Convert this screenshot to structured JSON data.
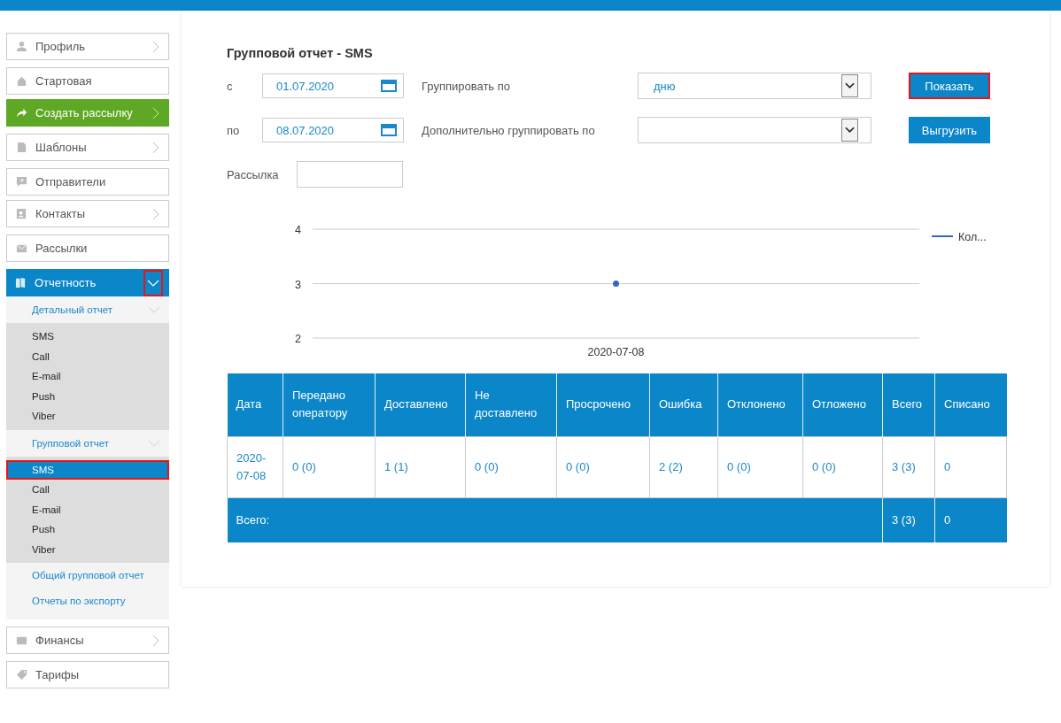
{
  "sidebar": {
    "groups": [
      {
        "items": [
          {
            "kind": "item",
            "label": "Профиль",
            "chevron": true
          }
        ]
      },
      {
        "items": [
          {
            "kind": "item",
            "label": "Стартовая",
            "chevron": false
          },
          {
            "kind": "primary",
            "label": "Создать рассылку",
            "chevron": true
          }
        ]
      },
      {
        "items": [
          {
            "kind": "item",
            "label": "Шаблоны",
            "chevron": true
          }
        ]
      },
      {
        "items": [
          {
            "kind": "item",
            "label": "Отправители",
            "chevron": false
          },
          {
            "kind": "item",
            "label": "Контакты",
            "chevron": true
          }
        ]
      },
      {
        "items": [
          {
            "kind": "item",
            "label": "Рассылки",
            "chevron": false
          }
        ]
      },
      {
        "items": [
          {
            "kind": "section",
            "label": "Отчетность",
            "expanded": true,
            "highlighted": true,
            "children": [
              {
                "kind": "group",
                "label": "Детальный отчет",
                "expanded": true,
                "children": [
                  {
                    "label": "SMS",
                    "selected": false,
                    "highlighted": false
                  },
                  {
                    "label": "Call",
                    "selected": false,
                    "highlighted": false
                  },
                  {
                    "label": "E-mail",
                    "selected": false,
                    "highlighted": false
                  },
                  {
                    "label": "Push",
                    "selected": false,
                    "highlighted": false
                  },
                  {
                    "label": "Viber",
                    "selected": false,
                    "highlighted": false
                  }
                ]
              },
              {
                "kind": "group",
                "label": "Групповой отчет",
                "expanded": true,
                "children": [
                  {
                    "label": "SMS",
                    "selected": true,
                    "highlighted": true
                  },
                  {
                    "label": "Call",
                    "selected": false,
                    "highlighted": false
                  },
                  {
                    "label": "E-mail",
                    "selected": false,
                    "highlighted": false
                  },
                  {
                    "label": "Push",
                    "selected": false,
                    "highlighted": false
                  },
                  {
                    "label": "Viber",
                    "selected": false,
                    "highlighted": false
                  }
                ]
              },
              {
                "kind": "link",
                "label": "Общий групповой отчет"
              },
              {
                "kind": "link",
                "label": "Отчеты по экспорту"
              }
            ]
          }
        ]
      },
      {
        "items": [
          {
            "kind": "item",
            "label": "Финансы",
            "chevron": true
          }
        ]
      },
      {
        "items": [
          {
            "kind": "item",
            "label": "Тарифы",
            "chevron": false
          }
        ]
      }
    ]
  },
  "report": {
    "title": "Групповой отчет - SMS",
    "from": {
      "label": "с",
      "value": "01.07.2020"
    },
    "to": {
      "label": "по",
      "value": "08.07.2020"
    },
    "group_by": {
      "label": "Группировать по",
      "value": "дню"
    },
    "group_by_extra": {
      "label": "Дополнительно группировать по"
    },
    "mailing": {
      "label": "Рассылка"
    },
    "buttons": [
      {
        "label": "Показать",
        "highlighted": true
      },
      {
        "label": "Выгрузить",
        "highlighted": false
      }
    ],
    "chart_data": {
      "type": "line",
      "categories": [
        "2020-07-08"
      ],
      "series": [
        {
          "name": "Кол...",
          "color": "#3366cc",
          "values": [
            3
          ],
          "marker": "circle"
        }
      ],
      "ylim": [
        2,
        4
      ],
      "yticks": [
        2,
        3,
        4
      ]
    },
    "table": {
      "columns": [
        "Дата",
        "Передано оператору",
        "Доставлено",
        "Не доставлено",
        "Просрочено",
        "Ошибка",
        "Отклонено",
        "Отложено",
        "Всего",
        "Списано"
      ],
      "rows": [
        {
          "cells": [
            "2020-07-08",
            "0 (0)",
            "1 (1)",
            "0 (0)",
            "0 (0)",
            "2 (2)",
            "0 (0)",
            "0 (0)",
            "3 (3)",
            "0"
          ]
        }
      ],
      "totals": {
        "label": "Всего:",
        "cells": [
          "3 (3)",
          "0"
        ]
      }
    }
  }
}
